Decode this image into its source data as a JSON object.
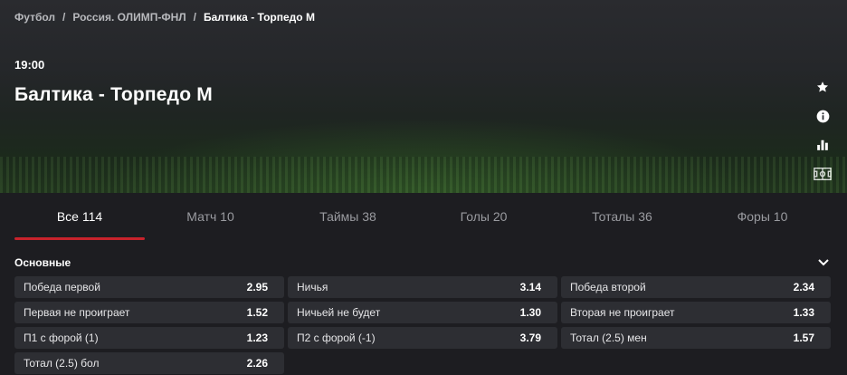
{
  "breadcrumb": {
    "items": [
      "Футбол",
      "Россия. ОЛИМП-ФНЛ",
      "Балтика - Торпедо М"
    ],
    "separator": "/"
  },
  "match": {
    "time": "19:00",
    "title": "Балтика - Торпедо М"
  },
  "side_icons": [
    "star-icon",
    "info-icon",
    "stats-icon",
    "field-icon"
  ],
  "tabs": [
    {
      "label": "Все 114",
      "active": true
    },
    {
      "label": "Матч 10",
      "active": false
    },
    {
      "label": "Таймы 38",
      "active": false
    },
    {
      "label": "Голы 20",
      "active": false
    },
    {
      "label": "Тоталы 36",
      "active": false
    },
    {
      "label": "Форы 10",
      "active": false
    }
  ],
  "section": {
    "title": "Основные",
    "expanded": true
  },
  "odds": [
    {
      "name": "Победа первой",
      "value": "2.95"
    },
    {
      "name": "Ничья",
      "value": "3.14"
    },
    {
      "name": "Победа второй",
      "value": "2.34"
    },
    {
      "name": "Первая не проиграет",
      "value": "1.52"
    },
    {
      "name": "Ничьей не будет",
      "value": "1.30"
    },
    {
      "name": "Вторая не проиграет",
      "value": "1.33"
    },
    {
      "name": "П1 с форой (1)",
      "value": "1.23"
    },
    {
      "name": "П2 с форой (-1)",
      "value": "3.79"
    },
    {
      "name": "Тотал (2.5) мен",
      "value": "1.57"
    },
    {
      "name": "Тотал (2.5) бол",
      "value": "2.26"
    }
  ],
  "colors": {
    "accent": "#c8232c",
    "background": "#1d1d21",
    "cell": "#2d2e33",
    "inactive_tab": "#9a9ba0"
  }
}
